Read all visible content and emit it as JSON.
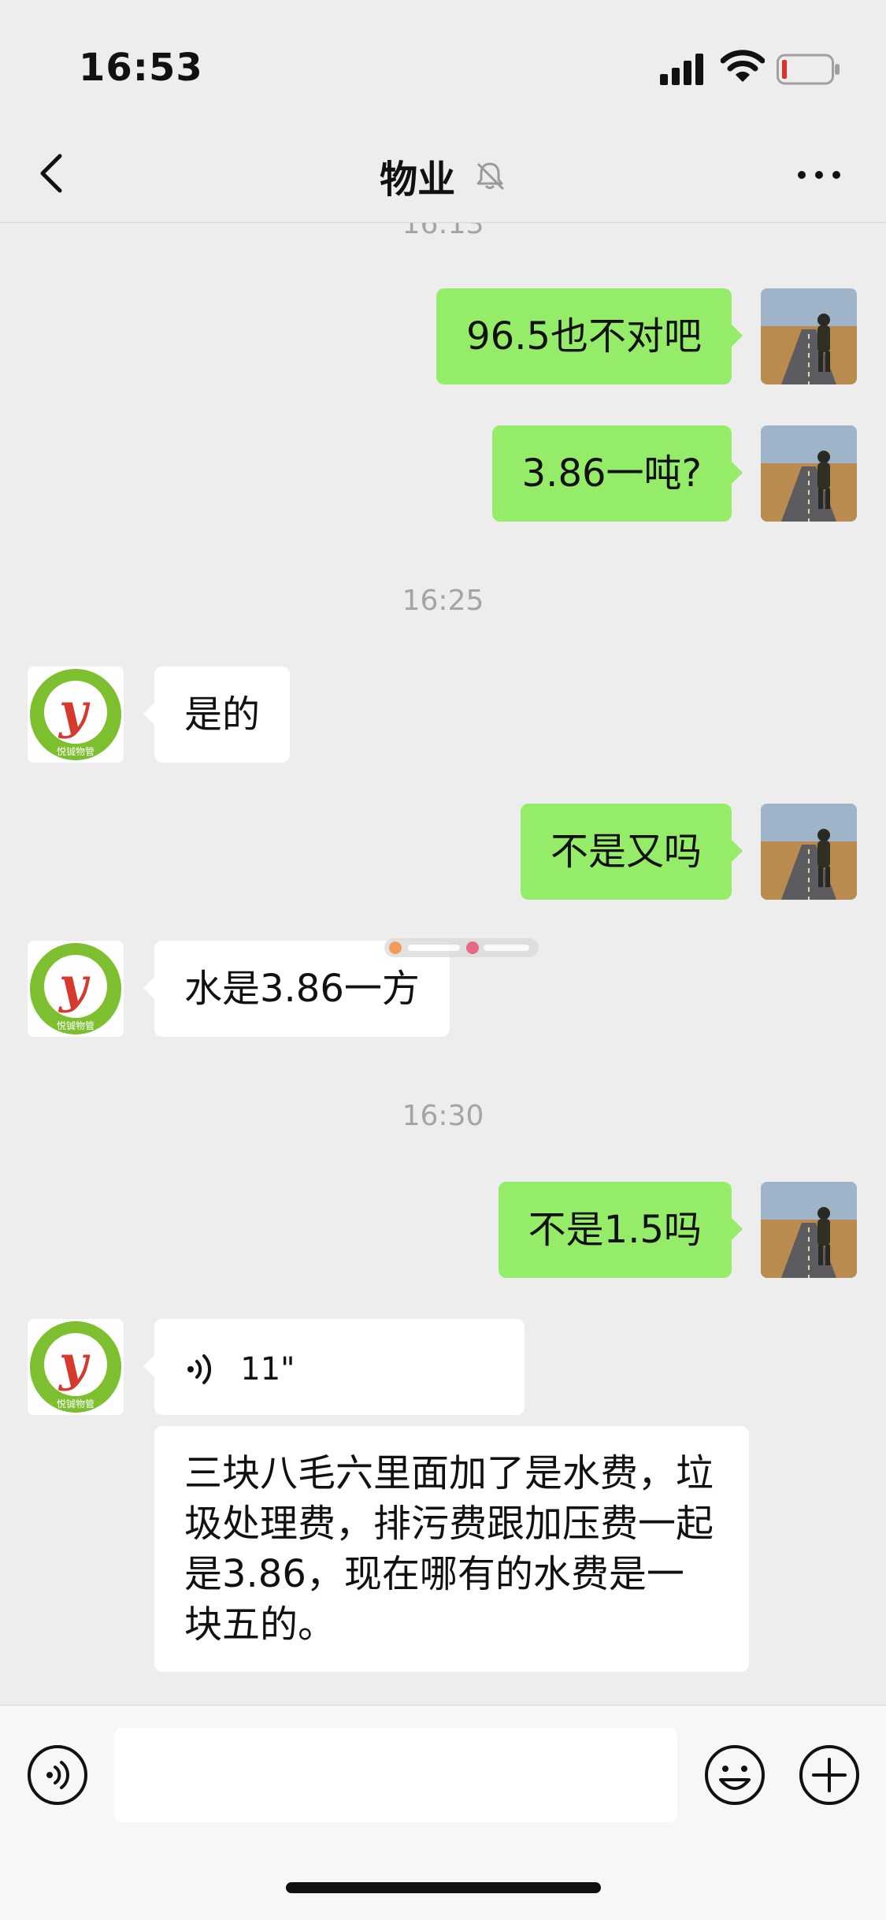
{
  "status_bar": {
    "time": "16:53"
  },
  "header": {
    "title": "物业"
  },
  "messages": {
    "ts_top": "16:13",
    "m1": "96.5也不对吧",
    "m2": "3.86一吨?",
    "ts_1": "16:25",
    "m3": "是的",
    "m4": "不是又吗",
    "m5": "水是3.86一方",
    "ts_2": "16:30",
    "m6": "不是1.5吗",
    "voice_duration": "11\"",
    "m7": "三块八毛六里面加了是水费，垃圾处理费，排污费跟加压费一起是3.86，现在哪有的水费是一块五的。"
  },
  "avatar_logo": {
    "letter": "y",
    "caption": "悦铖物管"
  },
  "colors": {
    "out_bubble": "#95ec69",
    "in_bubble": "#ffffff",
    "background": "#ededed",
    "logo_green": "#7cbf2f",
    "logo_red": "#d63a2f"
  },
  "icons": [
    "signal-icon",
    "wifi-icon",
    "battery-icon",
    "back-icon",
    "mute-icon",
    "more-icon",
    "voice-icon",
    "voice-input-icon",
    "emoji-icon",
    "plus-icon"
  ]
}
